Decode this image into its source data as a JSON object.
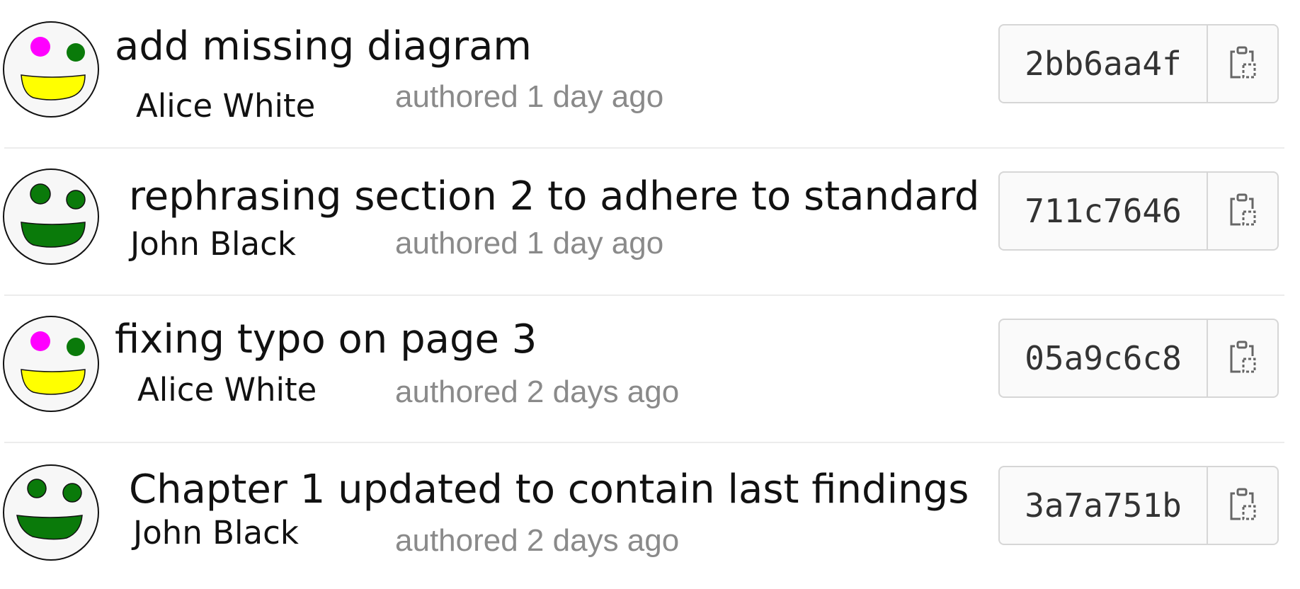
{
  "commits": [
    {
      "title": "add missing diagram",
      "author": "Alice White",
      "meta": "authored 1 day ago",
      "sha": "2bb6aa4f",
      "avatar": {
        "eye_left": "#ff00ff",
        "eye_right": "#0a7a0a",
        "mouth": "#ffff00"
      }
    },
    {
      "title": "rephrasing section 2 to adhere to standard",
      "author": "John Black",
      "meta": "authored 1 day ago",
      "sha": "711c7646",
      "avatar": {
        "eye_left": "#0a7a0a",
        "eye_right": "#0a7a0a",
        "mouth": "#0a7a0a"
      }
    },
    {
      "title": "fixing typo on page 3",
      "author": "Alice White",
      "meta": "authored 2 days ago",
      "sha": "05a9c6c8",
      "avatar": {
        "eye_left": "#ff00ff",
        "eye_right": "#0a7a0a",
        "mouth": "#ffff00"
      }
    },
    {
      "title": "Chapter 1 updated to contain last findings",
      "author": "John Black",
      "meta": "authored 2 days ago",
      "sha": "3a7a751b",
      "avatar": {
        "eye_left": "#0a7a0a",
        "eye_right": "#0a7a0a",
        "mouth": "#0a7a0a"
      }
    }
  ],
  "icons": {
    "copy": "clipboard-icon"
  }
}
